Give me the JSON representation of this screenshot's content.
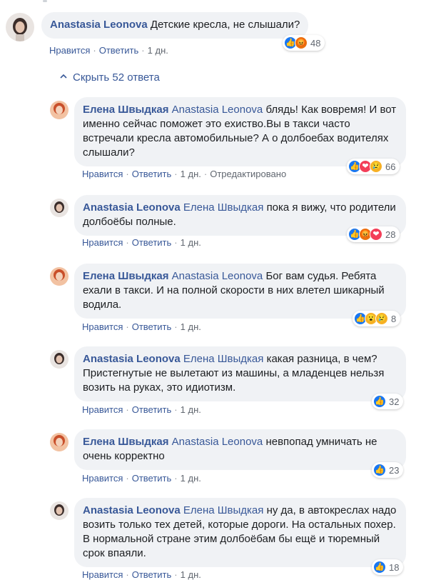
{
  "actions": {
    "like": "Нравится",
    "reply": "Ответить",
    "edited": "Отредактировано",
    "separator": "·"
  },
  "thread_toggle": {
    "label": "Скрыть 52 ответа",
    "icon": "chevron-up-icon"
  },
  "colors": {
    "link": "#385898",
    "bubble": "#f0f2f5",
    "meta": "#616770",
    "like": "#1877f2"
  },
  "root": {
    "author": "Anastasia Leonova",
    "text": "Детские кресла, не слышали?",
    "time": "1 дн.",
    "reactions": {
      "icons": [
        "like-icon",
        "angry-icon"
      ],
      "count": "48"
    }
  },
  "replies": [
    {
      "author": "Елена Швыдкая",
      "mention": "Anastasia Leonova",
      "text": "блядь! Как вовремя! И вот именно сейчас поможет это ехиство.Вы в такси часто встречали кресла автомобильные? А о долбоебах водителях слышали?",
      "time": "1 дн.",
      "edited": true,
      "reactions": {
        "icons": [
          "like-icon",
          "love-icon",
          "sad-icon"
        ],
        "count": "66"
      }
    },
    {
      "author": "Anastasia Leonova",
      "mention": "Елена Швыдкая",
      "text": "пока я вижу, что родители долбоёбы полные.",
      "time": "1 дн.",
      "reactions": {
        "icons": [
          "like-icon",
          "angry-icon",
          "love-icon"
        ],
        "count": "28"
      }
    },
    {
      "author": "Елена Швыдкая",
      "mention": "Anastasia Leonova",
      "text": "Бог вам судья. Ребята ехали в такси. И на полной скорости в них влетел шикарный водила.",
      "time": "1 дн.",
      "reactions": {
        "icons": [
          "like-icon",
          "wow-icon",
          "sad-icon"
        ],
        "count": "8"
      }
    },
    {
      "author": "Anastasia Leonova",
      "mention": "Елена Швыдкая",
      "text": "какая разница, в чем? Пристегнутые не вылетают из машины, а младенцев нельзя возить на руках, это идиотизм.",
      "time": "1 дн.",
      "reactions": {
        "icons": [
          "like-icon"
        ],
        "count": "32"
      }
    },
    {
      "author": "Елена Швыдкая",
      "mention": "Anastasia Leonova",
      "text": "невпопад умничать не очень корректно",
      "time": "1 дн.",
      "reactions": {
        "icons": [
          "like-icon"
        ],
        "count": "23"
      }
    },
    {
      "author": "Anastasia Leonova",
      "mention": "Елена Швыдкая",
      "text": "ну да, в автокреслах надо возить только тех детей, которые дороги. На остальных похер. В нормальной стране этим долбоёбам бы ещё и тюремный срок впаяли.",
      "time": "1 дн.",
      "reactions": {
        "icons": [
          "like-icon"
        ],
        "count": "18"
      }
    }
  ]
}
